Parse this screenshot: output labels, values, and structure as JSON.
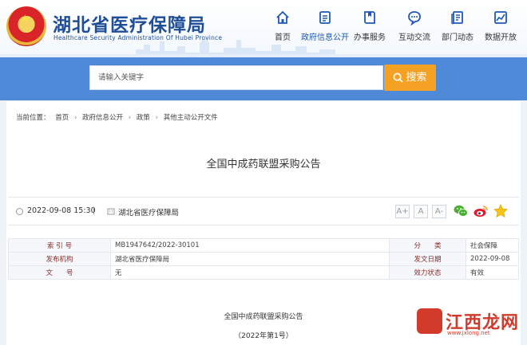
{
  "header": {
    "site_title": "湖北省医疗保障局",
    "site_subtitle": "Healthcare Security Administration Of Hubei Province",
    "nav": [
      {
        "label": "首页",
        "icon": "home-icon"
      },
      {
        "label": "政府信息公开",
        "icon": "document-icon",
        "active": true
      },
      {
        "label": "办事服务",
        "icon": "book-icon"
      },
      {
        "label": "互动交流",
        "icon": "chat-icon"
      },
      {
        "label": "部门动态",
        "icon": "news-icon"
      },
      {
        "label": "数据开放",
        "icon": "chart-icon"
      }
    ]
  },
  "search": {
    "value": "请输入关键字",
    "button_label": "搜索"
  },
  "breadcrumb": {
    "prefix": "当前位置：",
    "items": [
      "首页",
      "政府信息公开",
      "政策",
      "其他主动公开文件"
    ],
    "separator": "›"
  },
  "article": {
    "title": "全国中成药联盟采购公告",
    "date": "2022-09-08 15:30",
    "divider": "|",
    "publisher": "湖北省医疗保障局",
    "font_buttons": [
      "A+",
      "A",
      "A-"
    ]
  },
  "info_table": {
    "rows": [
      {
        "k1": "索 引 号",
        "v1": "MB1947642/2022-30101",
        "k2": "分　　类",
        "v2": "社会保障"
      },
      {
        "k1": "发布机构",
        "v1": "湖北省医疗保障局",
        "k2": "发文日期",
        "v2": "2022-09-08"
      },
      {
        "k1": "文　　号",
        "v1": "无",
        "k2": "效力状态",
        "v2": "有效"
      }
    ]
  },
  "body": {
    "doc_title": "全国中成药联盟采购公告",
    "doc_no": "（2022年第1号）"
  },
  "watermark": {
    "text": "江西龙网",
    "sub": "www.jxlong.net"
  },
  "colors": {
    "brand_blue": "#1f4e99",
    "band_blue": "#4f8ad8",
    "search_orange": "#f5a124",
    "label_red": "#8b2d2d"
  }
}
